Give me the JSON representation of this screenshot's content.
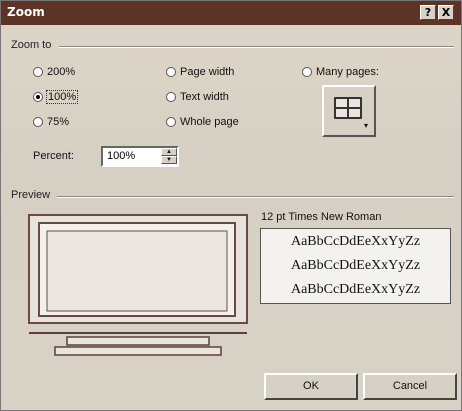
{
  "window": {
    "title": "Zoom",
    "help_label": "?",
    "close_label": "X"
  },
  "zoom_to": {
    "label": "Zoom to",
    "options": [
      {
        "label": "200%",
        "checked": false
      },
      {
        "label": "100%",
        "checked": true
      },
      {
        "label": "75%",
        "checked": false
      },
      {
        "label": "Page width",
        "checked": false
      },
      {
        "label": "Text width",
        "checked": false
      },
      {
        "label": "Whole page",
        "checked": false
      },
      {
        "label": "Many pages:",
        "checked": false
      }
    ]
  },
  "percent": {
    "label": "Percent:",
    "value": "100%"
  },
  "preview": {
    "label": "Preview",
    "font_label": "12 pt Times New Roman",
    "sample_lines": [
      "AaBbCcDdEeXxYyZz",
      "AaBbCcDdEeXxYyZz",
      "AaBbCcDdEeXxYyZz"
    ]
  },
  "buttons": {
    "ok": "OK",
    "cancel": "Cancel"
  }
}
